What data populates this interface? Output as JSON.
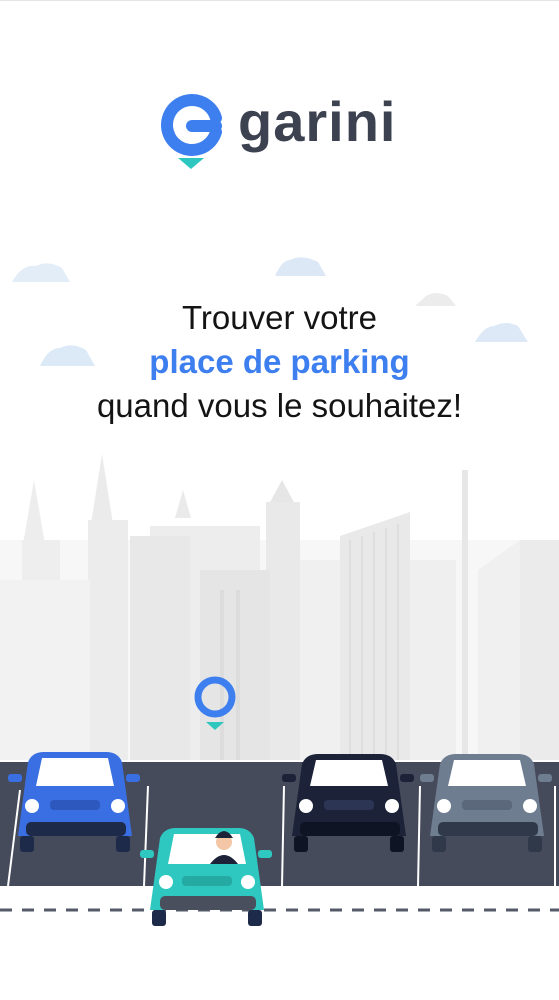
{
  "brand": {
    "name": "garini",
    "logo_icon": "location-pin-g-icon",
    "primary_color": "#3e7ff0",
    "accent_color": "#2ec7c0"
  },
  "headline": {
    "line1": "Trouver votre",
    "line2": "place de parking",
    "line3": "quand vous le souhaitez!"
  },
  "illustration": {
    "icons": [
      "cloud-icon",
      "city-skyline",
      "location-pin-icon",
      "car-icon",
      "driver-icon"
    ]
  }
}
